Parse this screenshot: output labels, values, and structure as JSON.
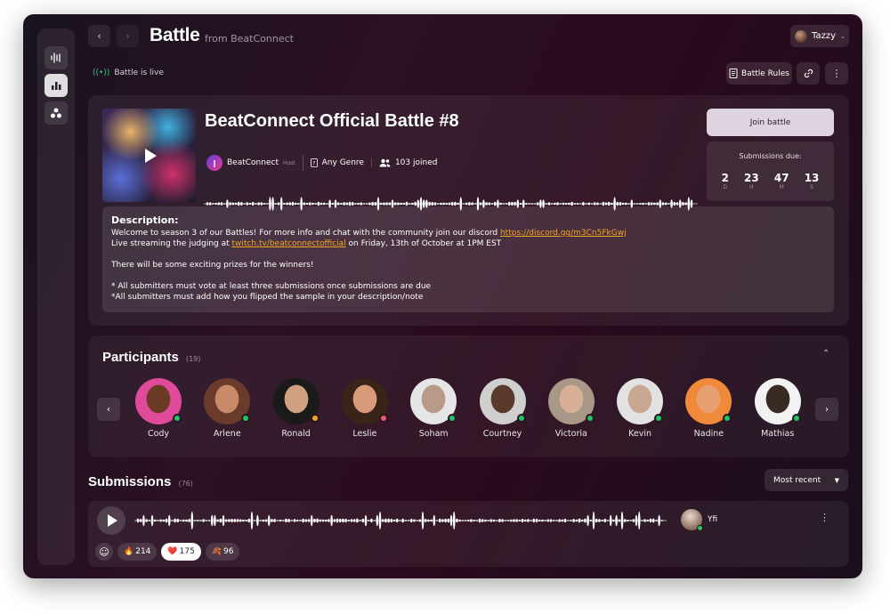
{
  "header": {
    "title": "Battle",
    "subtitle": "from BeatConnect",
    "user_name": "Tazzy",
    "live_status": "Battle is live",
    "rules_label": "Battle Rules"
  },
  "battle": {
    "name": "BeatConnect Official Battle #8",
    "host_name": "BeatConnect",
    "host_tag": "Host",
    "genre": "Any Genre",
    "joined": "103 joined",
    "join_label": "Join battle",
    "due_label": "Submissions due:",
    "countdown": [
      {
        "value": "2",
        "unit": "D"
      },
      {
        "value": "23",
        "unit": "H"
      },
      {
        "value": "47",
        "unit": "M"
      },
      {
        "value": "13",
        "unit": "S"
      }
    ]
  },
  "description": {
    "title": "Description:",
    "line1_text": "Welcome to season 3 of our Battles! For more info and chat with the community join our discord ",
    "line1_link": "https://discord.gg/m3Cn5FkGwj",
    "line2_text": "Live streaming the judging at ",
    "line2_link": "twitch.tv/beatconnectofficial",
    "line2_after": " on Friday, 13th of October at 1PM EST",
    "line3": "There will be some exciting prizes for the winners!",
    "line4": "* All submitters must vote at least three submissions once submissions are due",
    "line5": "*All submitters must add how you flipped the sample in your description/note"
  },
  "participants": {
    "title": "Participants",
    "count": "(19)",
    "people": [
      {
        "name": "Cody",
        "status_color": "#22c55e",
        "skin": "#6a3a24",
        "bg": "#e04a9a"
      },
      {
        "name": "Arlene",
        "status_color": "#22c55e",
        "skin": "#c98a6a",
        "bg": "#6a3a2a"
      },
      {
        "name": "Ronald",
        "status_color": "#f5a524",
        "skin": "#d0a080",
        "bg": "#1a1a1a"
      },
      {
        "name": "Leslie",
        "status_color": "#f05a6a",
        "skin": "#d89a78",
        "bg": "#3a2418"
      },
      {
        "name": "Soham",
        "status_color": "#22c55e",
        "skin": "#b89a88",
        "bg": "#e6e6e6"
      },
      {
        "name": "Courtney",
        "status_color": "#22c55e",
        "skin": "#5a3a2a",
        "bg": "#cfcfcf"
      },
      {
        "name": "Victoria",
        "status_color": "#22c55e",
        "skin": "#d8b098",
        "bg": "#a89888"
      },
      {
        "name": "Kevin",
        "status_color": "#22c55e",
        "skin": "#c8a890",
        "bg": "#e2e2e2"
      },
      {
        "name": "Nadine",
        "status_color": "#22c55e",
        "skin": "#e8a070",
        "bg": "#f08a3a"
      },
      {
        "name": "Mathias",
        "status_color": "#22c55e",
        "skin": "#3a2a24",
        "bg": "#f2f2f2"
      }
    ]
  },
  "submissions": {
    "title": "Submissions",
    "count": "(76)",
    "sort_label": "Most recent",
    "item": {
      "user": "Yfi",
      "reactions": [
        {
          "emoji": "🔥",
          "count": "214",
          "active": false
        },
        {
          "emoji": "❤️",
          "count": "175",
          "active": true
        },
        {
          "emoji": "🍂",
          "count": "96",
          "active": false
        }
      ]
    }
  }
}
